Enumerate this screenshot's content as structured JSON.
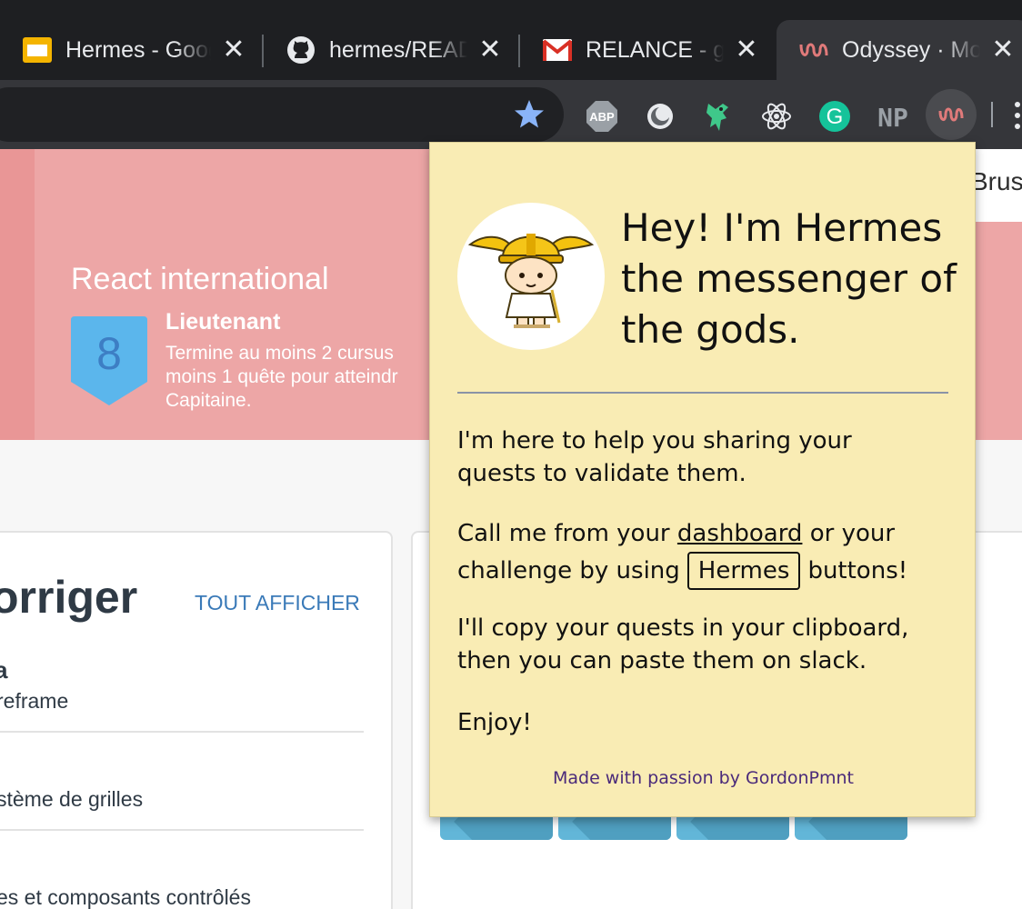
{
  "browser": {
    "tabs": [
      {
        "title": "Hermes - Goog",
        "icon": "google-slides-icon",
        "active": false
      },
      {
        "title": "hermes/READI",
        "icon": "github-icon",
        "active": false
      },
      {
        "title": "RELANCE - go",
        "icon": "gmail-icon",
        "active": false
      },
      {
        "title": "Odyssey · Mor",
        "icon": "odyssey-icon",
        "active": true
      }
    ],
    "close_glyph": "✕",
    "extensions": [
      {
        "name": "adblock-plus-icon",
        "label": "ABP"
      },
      {
        "name": "round-extension-icon",
        "label": ""
      },
      {
        "name": "green-mascot-icon",
        "label": ""
      },
      {
        "name": "react-devtools-icon",
        "label": ""
      },
      {
        "name": "grammarly-icon",
        "label": "G"
      },
      {
        "name": "np-extension-icon",
        "label": "NP"
      },
      {
        "name": "hermes-extension-icon",
        "label": ""
      }
    ]
  },
  "page": {
    "right_card_text": "Bruss",
    "banner": {
      "course_title": "React international",
      "badge_number": "8",
      "rank_title": "Lieutenant",
      "rank_desc_lines": [
        "Termine au moins 2 cursus",
        "moins 1 quête pour atteindr",
        "Capitaine."
      ]
    },
    "card_left": {
      "title": "orriger",
      "see_all": "TOUT AFFICHER",
      "rows": [
        "a",
        "reframe",
        "stème de grilles",
        "es et composants contrôlés"
      ]
    }
  },
  "popup": {
    "greeting": "Hey! I'm Hermes the messenger of the gods.",
    "p1_lines": [
      "I'm here to help you sharing your",
      "quests to validate them."
    ],
    "p2_line1_pre": "Call me from your",
    "p2_link": "dashboard",
    "p2_line1_post": "or your",
    "p2_line2_pre": "challenge by using",
    "p2_button": "Hermes",
    "p2_line2_post": "buttons!",
    "p3_lines": [
      "I'll copy your quests in your clipboard,",
      "then you can paste them on slack."
    ],
    "p4": "Enjoy!",
    "footer": "Made with passion by GordonPmnt"
  },
  "colors": {
    "tab_bg": "#1e1f22",
    "toolbar_bg": "#35363a",
    "banner": "#eda6a6",
    "badge": "#5bb6ec",
    "popup_bg": "#f9ecb4",
    "link_blue": "#3a7ab8"
  }
}
